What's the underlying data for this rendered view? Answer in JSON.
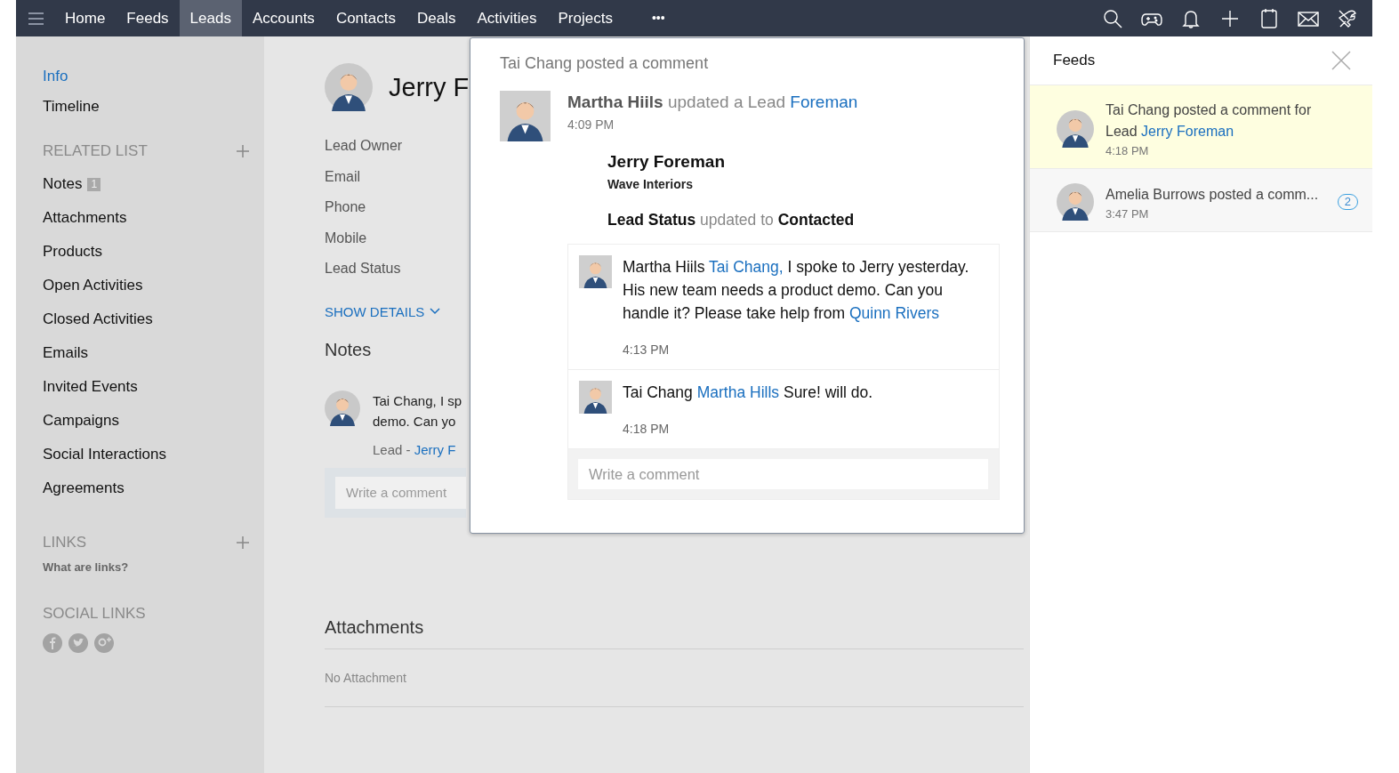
{
  "nav": {
    "items": [
      {
        "label": "Home",
        "selected": false
      },
      {
        "label": "Feeds",
        "selected": false
      },
      {
        "label": "Leads",
        "selected": true
      },
      {
        "label": "Accounts",
        "selected": false
      },
      {
        "label": "Contacts",
        "selected": false
      },
      {
        "label": "Deals",
        "selected": false
      },
      {
        "label": "Activities",
        "selected": false
      },
      {
        "label": "Projects",
        "selected": false
      }
    ],
    "more": "•••"
  },
  "sidebar": {
    "items": [
      {
        "label": "Info",
        "selected": true
      },
      {
        "label": "Timeline",
        "selected": false
      }
    ],
    "related_list": {
      "heading": "RELATED LIST",
      "items": [
        {
          "label": "Notes",
          "count": "1"
        },
        {
          "label": "Attachments"
        },
        {
          "label": "Products"
        },
        {
          "label": "Open Activities"
        },
        {
          "label": "Closed Activities"
        },
        {
          "label": "Emails"
        },
        {
          "label": "Invited Events"
        },
        {
          "label": "Campaigns"
        },
        {
          "label": "Social Interactions"
        },
        {
          "label": "Agreements"
        }
      ]
    },
    "links": {
      "heading": "LINKS",
      "help": "What are links?"
    },
    "social_links": {
      "heading": "SOCIAL LINKS"
    }
  },
  "record": {
    "title": "Jerry F",
    "fields": [
      "Lead Owner",
      "Email",
      "Phone",
      "Mobile",
      "Lead Status"
    ],
    "show_details": "SHOW DETAILS",
    "notes": {
      "heading": "Notes",
      "items": [
        {
          "lines": [
            "Tai Chang, I sp",
            "demo. Can yo"
          ],
          "lead_label": "Lead -",
          "lead_link": "Jerry F"
        }
      ],
      "comment_placeholder": "Write a comment"
    },
    "attachments": {
      "heading": "Attachments",
      "empty": "No Attachment"
    }
  },
  "popup": {
    "header": "Tai Chang posted a comment",
    "activity": {
      "actor": "Martha Hiils",
      "action": "updated a Lead",
      "link": "Foreman",
      "time": "4:09 PM"
    },
    "lead": {
      "name": "Jerry Foreman",
      "company": "Wave Interiors"
    },
    "update": {
      "field": "Lead Status",
      "verb": "updated to",
      "value": "Contacted"
    },
    "comments": [
      {
        "author": "Martha Hiils",
        "mention": "Tai Chang,",
        "text": "I spoke to Jerry yesterday. His new team needs a product demo. Can you handle it? Please take help from",
        "link": "Quinn Rivers",
        "time": "4:13 PM"
      },
      {
        "author": "Tai Chang",
        "mention": "Martha Hills",
        "text": "Sure! will do.",
        "time": "4:18 PM"
      }
    ],
    "comment_placeholder": "Write a comment"
  },
  "feeds": {
    "title": "Feeds",
    "items": [
      {
        "text": "Tai Chang posted a comment for Lead",
        "link": "Jerry Foreman",
        "time": "4:18 PM",
        "selected": true
      },
      {
        "text": "Amelia Burrows posted a comm...",
        "time": "3:47 PM",
        "selected": false,
        "count": "2"
      }
    ]
  }
}
